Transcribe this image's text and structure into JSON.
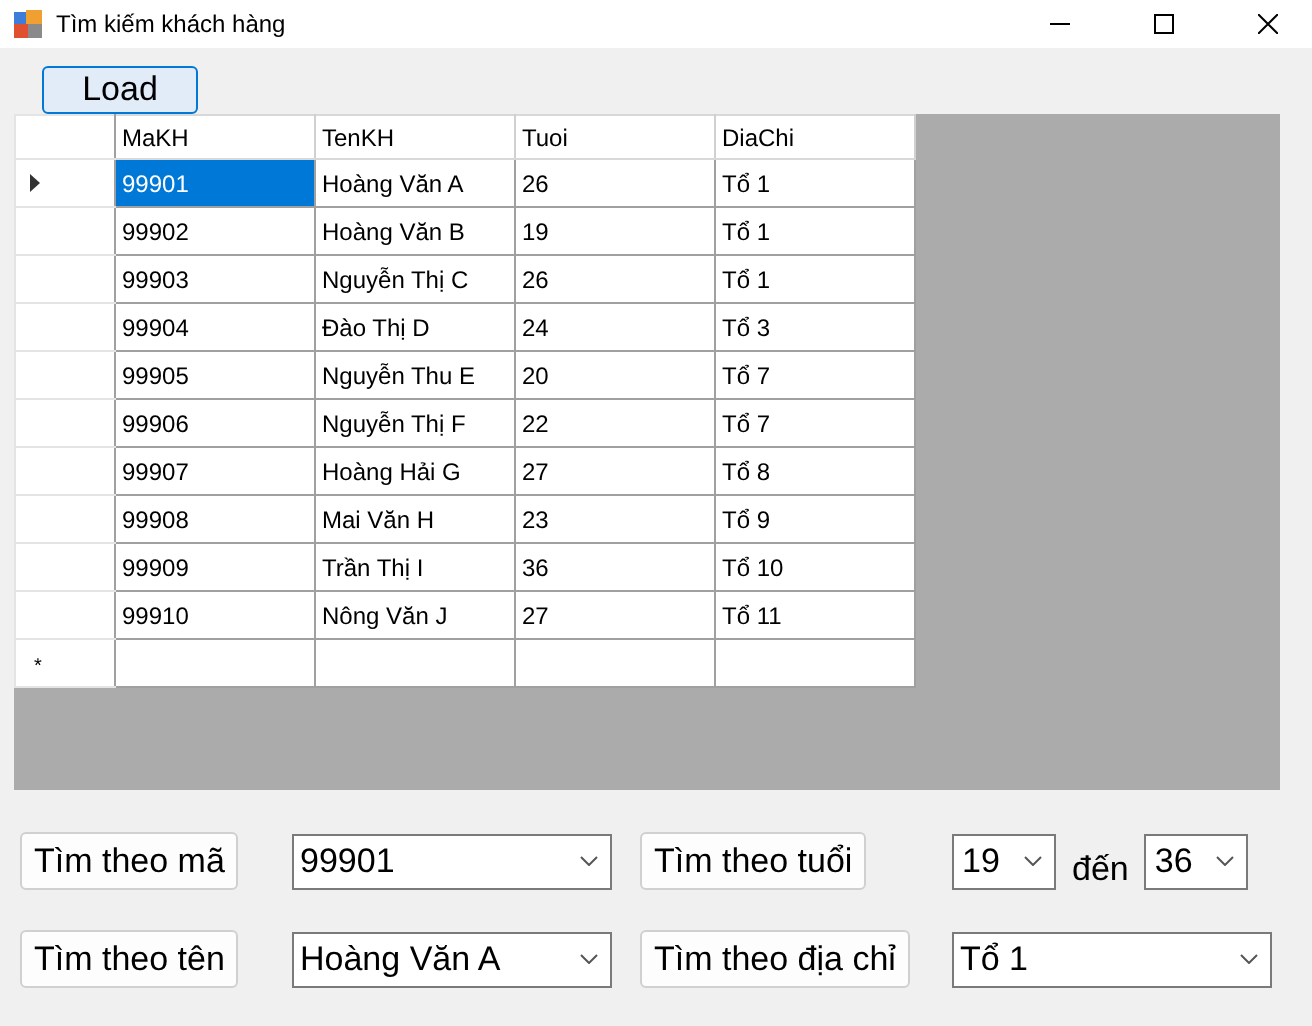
{
  "window": {
    "title": "Tìm kiếm khách hàng"
  },
  "load_button": "Load",
  "table": {
    "columns": [
      "MaKH",
      "TenKH",
      "Tuoi",
      "DiaChi"
    ],
    "rows": [
      {
        "cells": [
          "99901",
          "Hoàng Văn A",
          "26",
          "Tổ 1"
        ],
        "selected": true
      },
      {
        "cells": [
          "99902",
          "Hoàng Văn B",
          "19",
          "Tổ 1"
        ],
        "selected": false
      },
      {
        "cells": [
          "99903",
          "Nguyễn Thị C",
          "26",
          "Tổ 1"
        ],
        "selected": false
      },
      {
        "cells": [
          "99904",
          "Đào Thị D",
          "24",
          "Tổ 3"
        ],
        "selected": false
      },
      {
        "cells": [
          "99905",
          "Nguyễn Thu E",
          "20",
          "Tổ 7"
        ],
        "selected": false
      },
      {
        "cells": [
          "99906",
          "Nguyễn Thị F",
          "22",
          "Tổ 7"
        ],
        "selected": false
      },
      {
        "cells": [
          "99907",
          "Hoàng Hải G",
          "27",
          "Tổ 8"
        ],
        "selected": false
      },
      {
        "cells": [
          "99908",
          "Mai Văn H",
          "23",
          "Tổ 9"
        ],
        "selected": false
      },
      {
        "cells": [
          "99909",
          "Trần Thị I",
          "36",
          "Tổ 10"
        ],
        "selected": false
      },
      {
        "cells": [
          "99910",
          "Nông Văn J",
          "27",
          "Tổ 11"
        ],
        "selected": false
      }
    ],
    "new_row_marker": "*"
  },
  "search": {
    "by_code": {
      "button": "Tìm theo mã",
      "value": "99901"
    },
    "by_name": {
      "button": "Tìm theo tên",
      "value": "Hoàng Văn A"
    },
    "by_age": {
      "button": "Tìm theo tuổi",
      "from": "19",
      "separator": "đến",
      "to": "36"
    },
    "by_address": {
      "button": "Tìm theo địa chỉ",
      "value": "Tổ 1"
    }
  }
}
